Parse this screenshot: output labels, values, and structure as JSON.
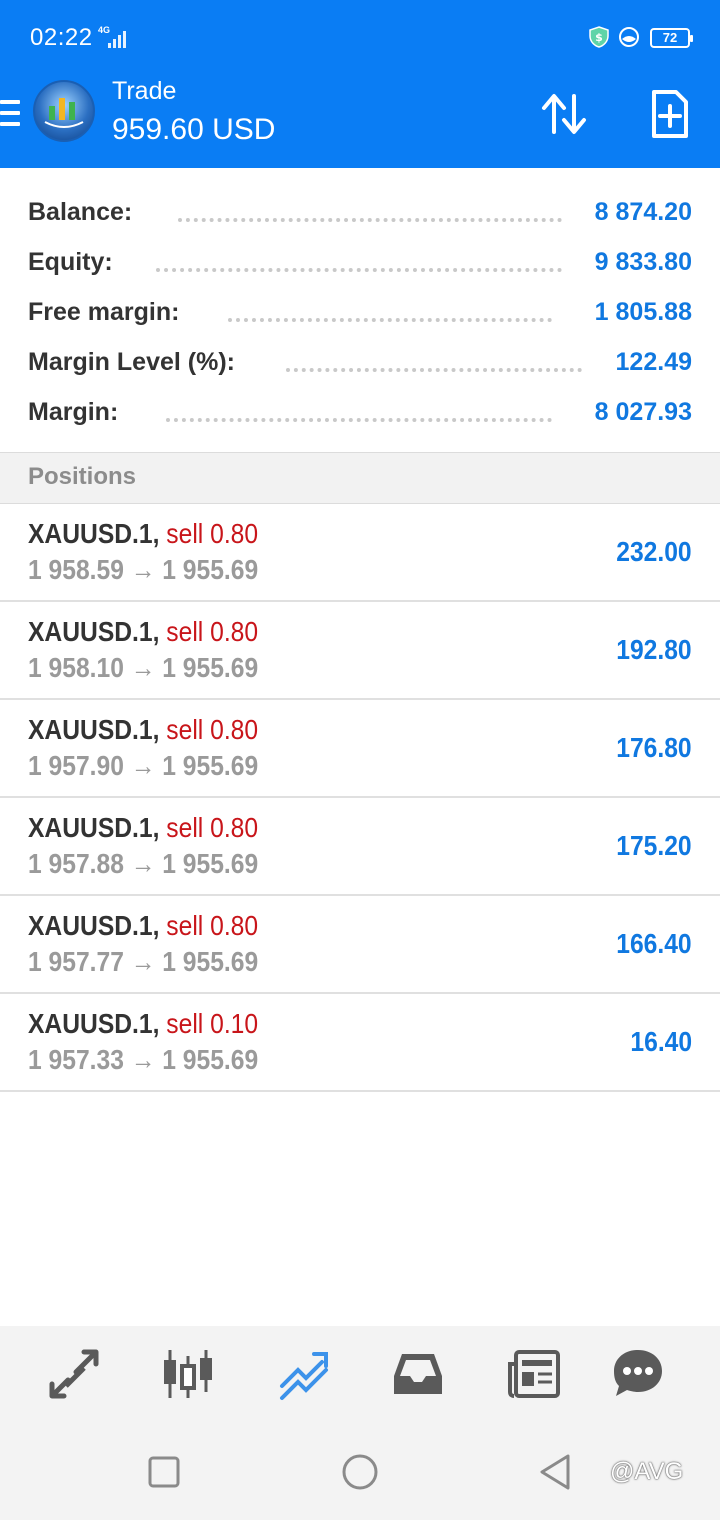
{
  "status_bar": {
    "time": "02:22",
    "network": "4G",
    "battery": "72"
  },
  "header": {
    "title": "Trade",
    "subtitle": "959.60 USD",
    "icons": [
      "menu-icon",
      "app-logo",
      "sort-icon",
      "new-order-icon"
    ]
  },
  "summary": [
    {
      "label": "Balance:",
      "value": "8 874.20"
    },
    {
      "label": "Equity:",
      "value": "9 833.80"
    },
    {
      "label": "Free margin:",
      "value": "1 805.88"
    },
    {
      "label": "Margin Level (%):",
      "value": "122.49"
    },
    {
      "label": "Margin:",
      "value": "8 027.93"
    }
  ],
  "positions_header": "Positions",
  "positions": [
    {
      "symbol": "XAUUSD.1,",
      "side": "sell 0.80",
      "prices": "1 958.59 → 1 955.69",
      "profit": "232.00"
    },
    {
      "symbol": "XAUUSD.1,",
      "side": "sell 0.80",
      "prices": "1 958.10 → 1 955.69",
      "profit": "192.80"
    },
    {
      "symbol": "XAUUSD.1,",
      "side": "sell 0.80",
      "prices": "1 957.90 → 1 955.69",
      "profit": "176.80"
    },
    {
      "symbol": "XAUUSD.1,",
      "side": "sell 0.80",
      "prices": "1 957.88 → 1 955.69",
      "profit": "175.20"
    },
    {
      "symbol": "XAUUSD.1,",
      "side": "sell 0.80",
      "prices": "1 957.77 → 1 955.69",
      "profit": "166.40"
    },
    {
      "symbol": "XAUUSD.1,",
      "side": "sell 0.10",
      "prices": "1 957.33 → 1 955.69",
      "profit": "16.40"
    }
  ],
  "bottom_nav": [
    "quotes-icon",
    "chart-icon",
    "trade-icon",
    "history-icon",
    "news-icon",
    "chat-icon"
  ],
  "watermark": "@AVG",
  "colors": {
    "header": "#0a7df4",
    "value_blue": "#1078e0",
    "sell_red": "#c8151a",
    "active_tab": "#3c92ea"
  }
}
